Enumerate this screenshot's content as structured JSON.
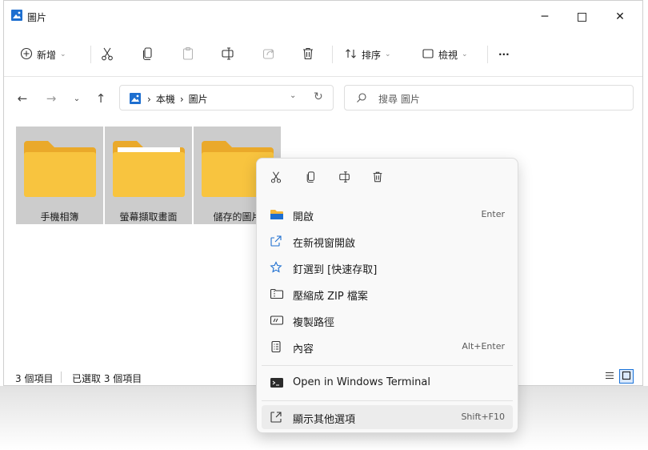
{
  "window": {
    "title": "圖片"
  },
  "toolbar": {
    "new_label": "新增",
    "sort_label": "排序",
    "view_label": "檢視",
    "more_label": "···"
  },
  "address": {
    "crumbs": [
      "本機",
      "圖片"
    ],
    "search_placeholder": "搜尋 圖片"
  },
  "folders": [
    {
      "name": "手機相簿"
    },
    {
      "name": "螢幕擷取畫面"
    },
    {
      "name": "儲存的圖片"
    }
  ],
  "status": {
    "item_count": "3 個項目",
    "selected_count": "已選取 3 個項目"
  },
  "context_menu": {
    "items": [
      {
        "label": "開啟",
        "shortcut": "Enter"
      },
      {
        "label": "在新視窗開啟",
        "shortcut": ""
      },
      {
        "label": "釘選到 [快速存取]",
        "shortcut": ""
      },
      {
        "label": "壓縮成 ZIP 檔案",
        "shortcut": ""
      },
      {
        "label": "複製路徑",
        "shortcut": ""
      },
      {
        "label": "內容",
        "shortcut": "Alt+Enter"
      },
      {
        "label": "Open in Windows Terminal",
        "shortcut": ""
      },
      {
        "label": "顯示其他選項",
        "shortcut": "Shift+F10"
      }
    ]
  },
  "colors": {
    "accent": "#1a73d9",
    "folder": "#f8c43f",
    "folder_dark": "#eaa92a",
    "selection": "#cccccc"
  }
}
